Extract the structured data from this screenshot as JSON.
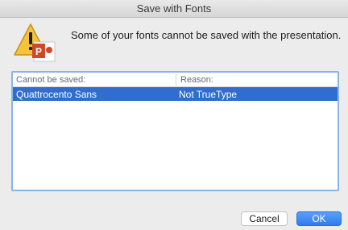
{
  "window": {
    "title": "Save with Fonts"
  },
  "icons": {
    "alert": "warning-powerpoint-icon"
  },
  "message": "Some of your fonts cannot be saved with the presentation.",
  "table": {
    "headers": [
      "Cannot be saved:",
      "Reason:"
    ],
    "rows": [
      {
        "font": "Quattrocento Sans",
        "reason": "Not TrueType",
        "selected": true
      }
    ]
  },
  "buttons": {
    "cancel": "Cancel",
    "ok": "OK"
  },
  "colors": {
    "selection": "#2f6ecf",
    "default_button": "#3b82f0",
    "focus_ring": "#8ab4ee"
  }
}
